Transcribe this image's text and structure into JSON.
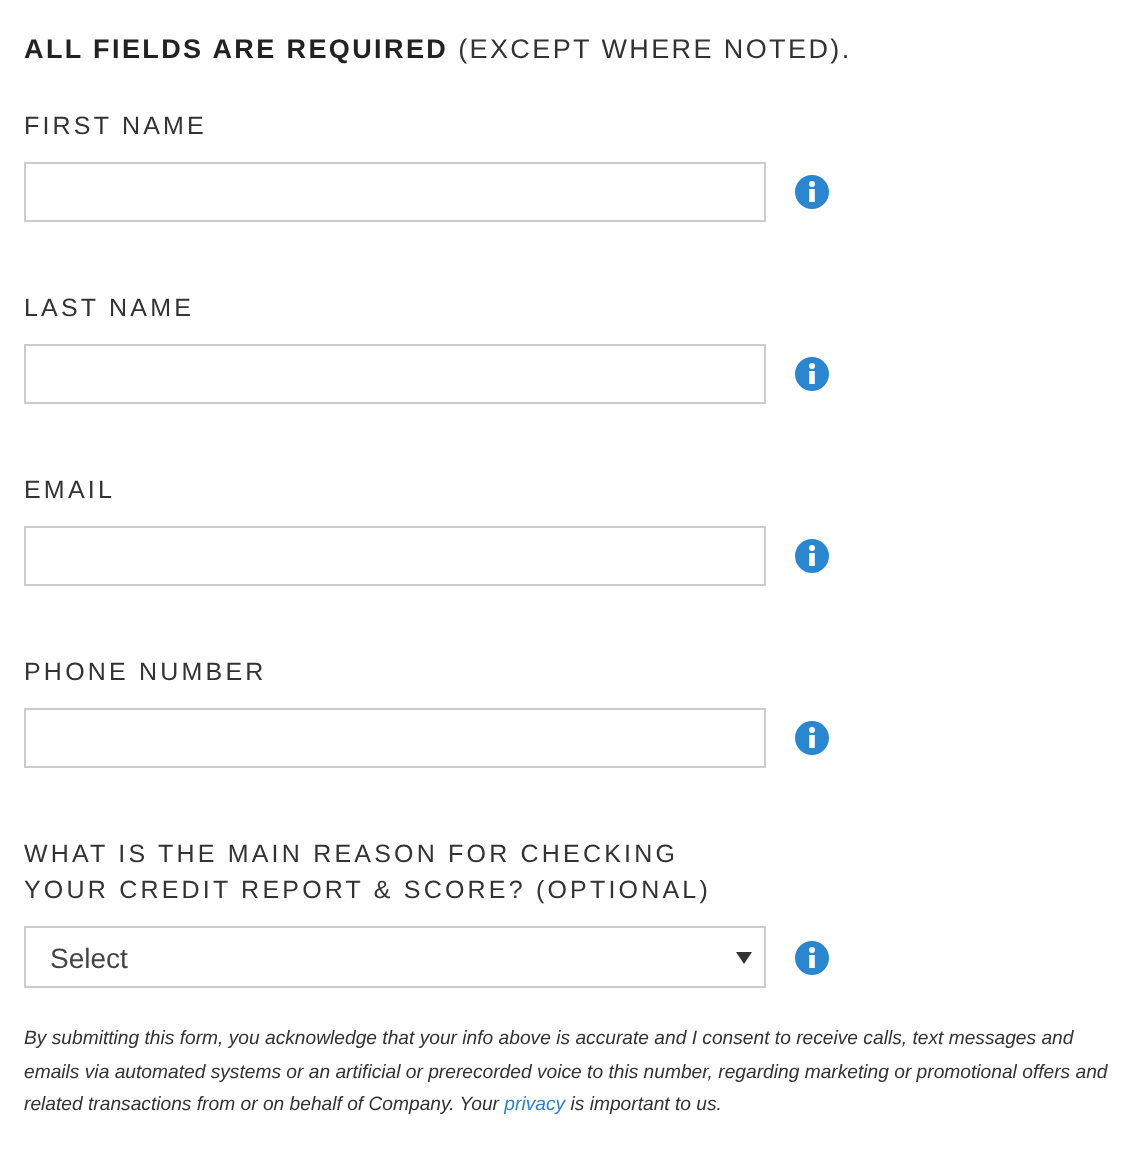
{
  "heading": {
    "bold": "ALL FIELDS ARE REQUIRED",
    "rest": "(EXCEPT WHERE NOTED)."
  },
  "fields": [
    {
      "kind": "text",
      "label": "FIRST NAME"
    },
    {
      "kind": "text",
      "label": "LAST NAME"
    },
    {
      "kind": "text",
      "label": "EMAIL"
    },
    {
      "kind": "text",
      "label": "PHONE NUMBER"
    },
    {
      "kind": "select",
      "label": "WHAT IS THE MAIN REASON FOR CHECKING YOUR CREDIT REPORT & SCORE? (OPTIONAL)",
      "value": "Select"
    }
  ],
  "disclaimer": {
    "text": "By submitting this form, you acknowledge that your info above is accurate and I consent to receive calls, text messages and emails via automated systems or an artificial or prerecorded voice to this number, regarding marketing or promotional offers and related transactions from or on behalf of Company. Your",
    "link": "privacy",
    "text_end": "is important to us."
  }
}
